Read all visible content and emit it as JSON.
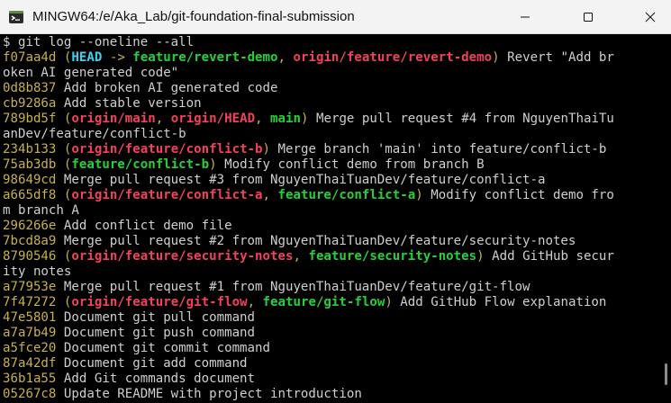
{
  "window": {
    "title": "MINGW64:/e/Aka_Lab/git-foundation-final-submission",
    "icon": "git-bash-icon",
    "controls": [
      "minimize-icon",
      "maximize-icon",
      "close-icon"
    ]
  },
  "colors": {
    "hash": "#c7b14a",
    "head": "#3fd2f0",
    "remote_branch": "#f2415b",
    "local_branch": "#25d13a",
    "text": "#cfcfcf",
    "background": "#000000"
  },
  "terminal": {
    "lines": [
      [
        {
          "t": "$ git log --oneline --all",
          "c": ""
        }
      ],
      [
        {
          "t": "f07aa4d",
          "c": "hash"
        },
        {
          "t": " (",
          "c": "paren"
        },
        {
          "t": "HEAD",
          "c": "head"
        },
        {
          "t": " -> ",
          "c": "arrow"
        },
        {
          "t": "feature/revert-demo",
          "c": "local"
        },
        {
          "t": ", ",
          "c": "sep"
        },
        {
          "t": "origin/feature/revert-demo",
          "c": "remote"
        },
        {
          "t": ")",
          "c": "paren"
        },
        {
          "t": " Revert \"Add br",
          "c": ""
        }
      ],
      [
        {
          "t": "oken AI generated code\"",
          "c": ""
        }
      ],
      [
        {
          "t": "0d8b837",
          "c": "hash"
        },
        {
          "t": " Add broken AI generated code",
          "c": ""
        }
      ],
      [
        {
          "t": "cb9286a",
          "c": "hash"
        },
        {
          "t": " Add stable version",
          "c": ""
        }
      ],
      [
        {
          "t": "789bd5f",
          "c": "hash"
        },
        {
          "t": " (",
          "c": "paren"
        },
        {
          "t": "origin/main",
          "c": "remote"
        },
        {
          "t": ", ",
          "c": "sep"
        },
        {
          "t": "origin/HEAD",
          "c": "remote"
        },
        {
          "t": ", ",
          "c": "sep"
        },
        {
          "t": "main",
          "c": "local"
        },
        {
          "t": ")",
          "c": "paren"
        },
        {
          "t": " Merge pull request #4 from NguyenThaiTu",
          "c": ""
        }
      ],
      [
        {
          "t": "anDev/feature/conflict-b",
          "c": ""
        }
      ],
      [
        {
          "t": "234b133",
          "c": "hash"
        },
        {
          "t": " (",
          "c": "paren"
        },
        {
          "t": "origin/feature/conflict-b",
          "c": "remote"
        },
        {
          "t": ")",
          "c": "paren"
        },
        {
          "t": " Merge branch 'main' into feature/conflict-b",
          "c": ""
        }
      ],
      [
        {
          "t": "75ab3db",
          "c": "hash"
        },
        {
          "t": " (",
          "c": "paren"
        },
        {
          "t": "feature/conflict-b",
          "c": "local"
        },
        {
          "t": ")",
          "c": "paren"
        },
        {
          "t": " Modify conflict demo from branch B",
          "c": ""
        }
      ],
      [
        {
          "t": "98649cd",
          "c": "hash"
        },
        {
          "t": " Merge pull request #3 from NguyenThaiTuanDev/feature/conflict-a",
          "c": ""
        }
      ],
      [
        {
          "t": "a665df8",
          "c": "hash"
        },
        {
          "t": " (",
          "c": "paren"
        },
        {
          "t": "origin/feature/conflict-a",
          "c": "remote"
        },
        {
          "t": ", ",
          "c": "sep"
        },
        {
          "t": "feature/conflict-a",
          "c": "local"
        },
        {
          "t": ")",
          "c": "paren"
        },
        {
          "t": " Modify conflict demo fro",
          "c": ""
        }
      ],
      [
        {
          "t": "m branch A",
          "c": ""
        }
      ],
      [
        {
          "t": "296266e",
          "c": "hash"
        },
        {
          "t": " Add conflict demo file",
          "c": ""
        }
      ],
      [
        {
          "t": "7bcd8a9",
          "c": "hash"
        },
        {
          "t": " Merge pull request #2 from NguyenThaiTuanDev/feature/security-notes",
          "c": ""
        }
      ],
      [
        {
          "t": "8790546",
          "c": "hash"
        },
        {
          "t": " (",
          "c": "paren"
        },
        {
          "t": "origin/feature/security-notes",
          "c": "remote"
        },
        {
          "t": ", ",
          "c": "sep"
        },
        {
          "t": "feature/security-notes",
          "c": "local"
        },
        {
          "t": ")",
          "c": "paren"
        },
        {
          "t": " Add GitHub secur",
          "c": ""
        }
      ],
      [
        {
          "t": "ity notes",
          "c": ""
        }
      ],
      [
        {
          "t": "a77953e",
          "c": "hash"
        },
        {
          "t": " Merge pull request #1 from NguyenThaiTuanDev/feature/git-flow",
          "c": ""
        }
      ],
      [
        {
          "t": "7f47272",
          "c": "hash"
        },
        {
          "t": " (",
          "c": "paren"
        },
        {
          "t": "origin/feature/git-flow",
          "c": "remote"
        },
        {
          "t": ", ",
          "c": "sep"
        },
        {
          "t": "feature/git-flow",
          "c": "local"
        },
        {
          "t": ")",
          "c": "paren"
        },
        {
          "t": " Add GitHub Flow explanation",
          "c": ""
        }
      ],
      [
        {
          "t": "47e5801",
          "c": "hash"
        },
        {
          "t": " Document git pull command",
          "c": ""
        }
      ],
      [
        {
          "t": "a7a7b49",
          "c": "hash"
        },
        {
          "t": " Document git push command",
          "c": ""
        }
      ],
      [
        {
          "t": "a5fce20",
          "c": "hash"
        },
        {
          "t": " Document git commit command",
          "c": ""
        }
      ],
      [
        {
          "t": "87a42df",
          "c": "hash"
        },
        {
          "t": " Document git add command",
          "c": ""
        }
      ],
      [
        {
          "t": "36b1a55",
          "c": "hash"
        },
        {
          "t": " Add Git commands document",
          "c": ""
        }
      ],
      [
        {
          "t": "05267c8",
          "c": "hash"
        },
        {
          "t": " Update README with project introduction",
          "c": ""
        }
      ]
    ]
  }
}
